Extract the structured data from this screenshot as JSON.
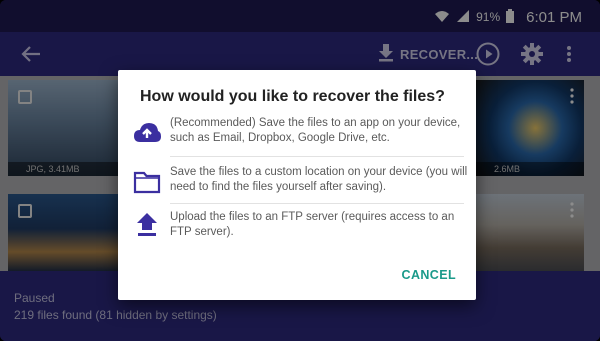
{
  "status_bar": {
    "battery_percent": "91%",
    "time": "6:01 PM"
  },
  "toolbar": {
    "recover_label": "RECOVER...",
    "icons": [
      "back-icon",
      "download-icon",
      "play-icon",
      "gear-icon",
      "more-icon"
    ]
  },
  "gallery": {
    "tiles": [
      {
        "meta": "JPG, 3.41MB"
      },
      {
        "meta": "2.6MB"
      },
      {
        "meta": ""
      },
      {
        "meta": ""
      }
    ]
  },
  "bottom_bar": {
    "status": "Paused",
    "found": "219 files found (81 hidden by settings)"
  },
  "dialog": {
    "title": "How would you like to recover the files?",
    "options": [
      {
        "icon": "cloud-upload-icon",
        "text": "(Recommended) Save the files to an app on your device, such as Email, Dropbox, Google Drive, etc."
      },
      {
        "icon": "folder-icon",
        "text": "Save the files to a custom location on your device (you will need to find the files yourself after saving)."
      },
      {
        "icon": "upload-icon",
        "text": "Upload the files to an FTP server (requires access to an FTP server)."
      }
    ],
    "cancel_label": "CANCEL"
  },
  "colors": {
    "primary": "#2f2a82",
    "status_bar": "#1f1a54",
    "icon_accent": "#3b2fa0",
    "cancel_accent": "#1a9a8a"
  }
}
